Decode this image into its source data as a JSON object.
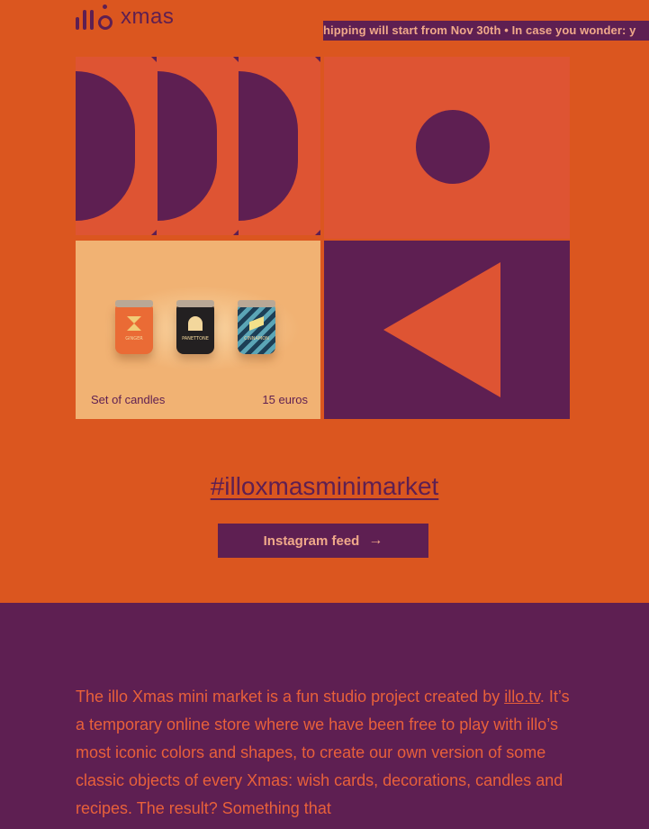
{
  "header": {
    "logo_text": "xmas",
    "ticker": "hipping will start from Nov 30th • In case you wonder: y"
  },
  "product": {
    "name": "Set of candles",
    "price": "15 euros",
    "candles": [
      {
        "label": "GINGER"
      },
      {
        "label": "PANETTONE"
      },
      {
        "label": "CINNAMON"
      }
    ]
  },
  "social": {
    "hashtag": "#illoxmasminimarket",
    "button_label": "Instagram feed",
    "button_icon": "arrow-right-icon"
  },
  "about": {
    "text_before_link": "The illo Xmas mini market is a fun studio project created by ",
    "link_text": "illo.tv",
    "text_after_link": ". It’s a temporary online store where we have been free to play with illo’s most iconic colors and shapes, to create our own version of some classic objects of every Xmas: wish cards, decorations, candles and recipes. The result? Something that"
  },
  "colors": {
    "background": "#db561f",
    "purple": "#5e1f52",
    "coral": "#de5433",
    "peach": "#f1b273",
    "text_pink": "#f0a98a"
  }
}
